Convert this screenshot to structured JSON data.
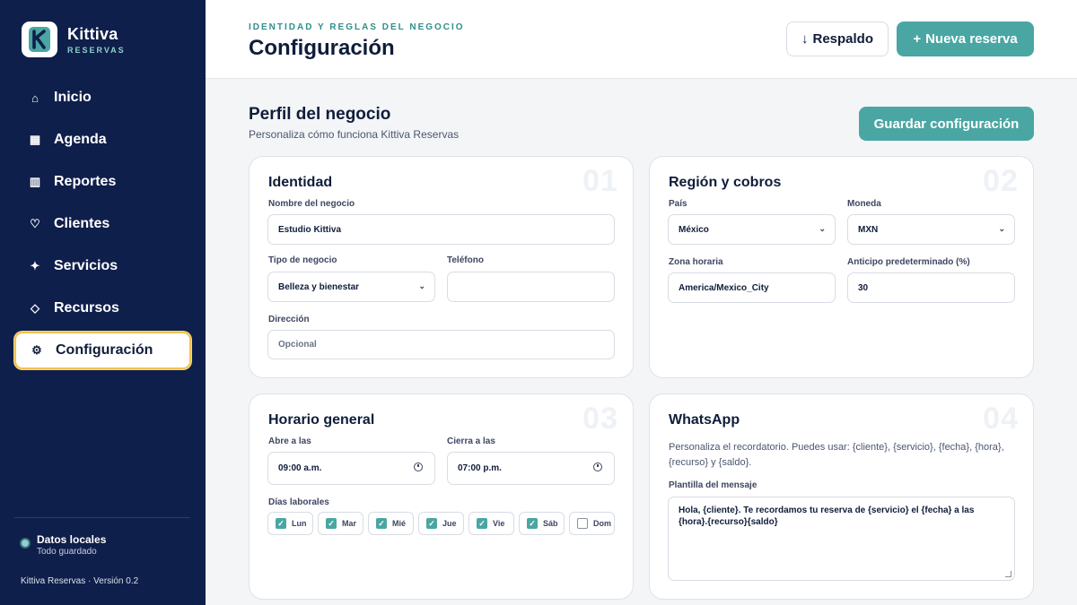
{
  "brand": {
    "name": "Kittiva",
    "sub": "RESERVAS",
    "logo_letter": "K"
  },
  "sidebar": {
    "items": [
      {
        "label": "Inicio",
        "icon": "home-icon",
        "glyph": "⌂"
      },
      {
        "label": "Agenda",
        "icon": "calendar-icon",
        "glyph": "▦"
      },
      {
        "label": "Reportes",
        "icon": "reports-icon",
        "glyph": "▥"
      },
      {
        "label": "Clientes",
        "icon": "heart-icon",
        "glyph": "♡"
      },
      {
        "label": "Servicios",
        "icon": "sparkle-icon",
        "glyph": "✦"
      },
      {
        "label": "Recursos",
        "icon": "diamond-icon",
        "glyph": "◇"
      },
      {
        "label": "Configuración",
        "icon": "gear-icon",
        "glyph": "⚙"
      }
    ],
    "active_index": 6,
    "status_title": "Datos locales",
    "status_sub": "Todo guardado",
    "version": "Kittiva Reservas · Versión 0.2"
  },
  "header": {
    "eyebrow": "IDENTIDAD Y REGLAS DEL NEGOCIO",
    "title": "Configuración",
    "backup_label": "Respaldo",
    "backup_glyph": "↓",
    "new_label": "Nueva reserva",
    "new_glyph": "+"
  },
  "section": {
    "title": "Perfil del negocio",
    "subtitle": "Personaliza cómo funciona Kittiva Reservas",
    "save_label": "Guardar configuración"
  },
  "identity": {
    "num": "01",
    "title": "Identidad",
    "name_label": "Nombre del negocio",
    "name_value": "Estudio Kittiva",
    "type_label": "Tipo de negocio",
    "type_value": "Belleza y bienestar",
    "phone_label": "Teléfono",
    "phone_value": "",
    "address_label": "Dirección",
    "address_placeholder": "Opcional"
  },
  "region": {
    "num": "02",
    "title": "Región y cobros",
    "country_label": "País",
    "country_value": "México",
    "currency_label": "Moneda",
    "currency_value": "MXN",
    "tz_label": "Zona horaria",
    "tz_value": "America/Mexico_City",
    "deposit_label": "Anticipo predeterminado (%)",
    "deposit_value": "30"
  },
  "schedule": {
    "num": "03",
    "title": "Horario general",
    "open_label": "Abre a las",
    "open_value": "09:00 a.m.",
    "close_label": "Cierra a las",
    "close_value": "07:00 p.m.",
    "days_label": "Días laborales",
    "days": [
      {
        "label": "Lun",
        "checked": true
      },
      {
        "label": "Mar",
        "checked": true
      },
      {
        "label": "Mié",
        "checked": true
      },
      {
        "label": "Jue",
        "checked": true
      },
      {
        "label": "Vie",
        "checked": true
      },
      {
        "label": "Sáb",
        "checked": true
      },
      {
        "label": "Dom",
        "checked": false
      }
    ]
  },
  "whatsapp": {
    "num": "04",
    "title": "WhatsApp",
    "description": "Personaliza el recordatorio. Puedes usar: {cliente}, {servicio}, {fecha}, {hora}, {recurso} y {saldo}.",
    "template_label": "Plantilla del mensaje",
    "template_value": "Hola, {cliente}. Te recordamos tu reserva de {servicio} el {fecha} a las {hora}.{recurso}{saldo}"
  },
  "colors": {
    "sidebar": "#0f1f4b",
    "accent": "#4aa6a2",
    "active_border": "#f1c24c"
  }
}
